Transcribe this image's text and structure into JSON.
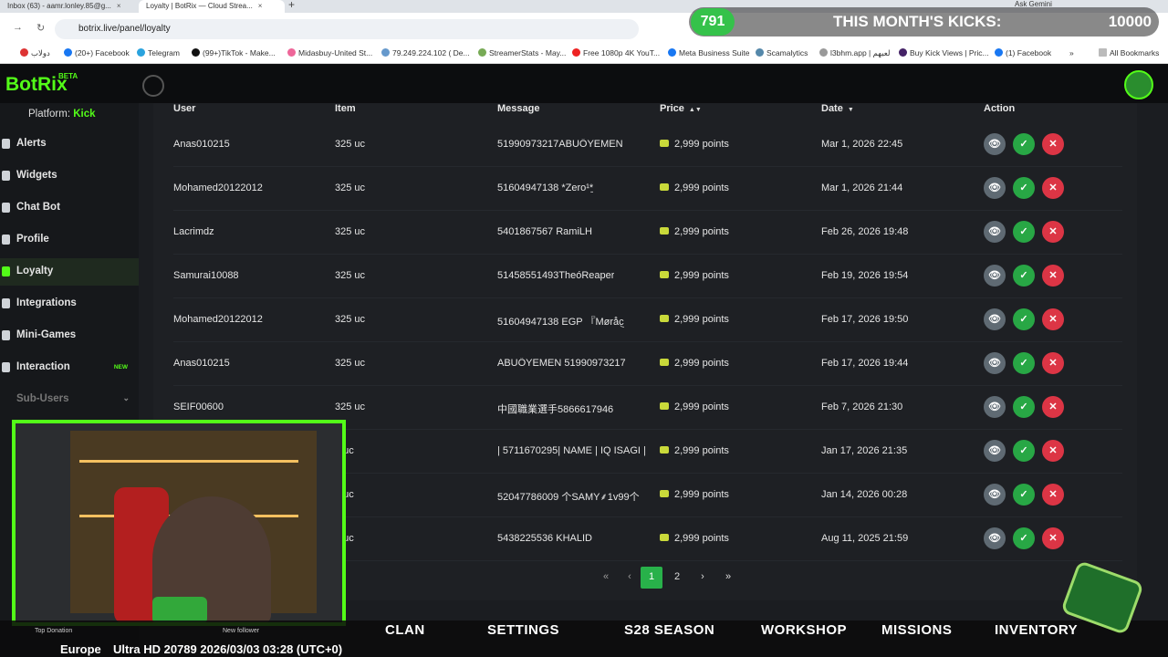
{
  "browser": {
    "tabs": [
      {
        "label": "Inbox (63) - aamr.lonley.85@g..."
      },
      {
        "label": "Loyalty | BotRix — Cloud Strea..."
      }
    ],
    "new_tab": "+",
    "ask_gemini": "Ask Gemini",
    "url": "botrix.live/panel/loyalty",
    "bookmarks": [
      "دولاب",
      "(20+) Facebook",
      "Telegram",
      "(99+)TikTok - Make...",
      "Midasbuy-United St...",
      "79.249.224.102 ( De...",
      "StreamerStats - May...",
      "Free 1080p 4K YouT...",
      "Meta Business Suite",
      "Scamalytics",
      "l3bhm.app | لعبهم",
      "Buy Kick Views | Pric...",
      "(1) Facebook",
      "»",
      "All Bookmarks"
    ]
  },
  "kicks_overlay": {
    "count": "791",
    "label": "THIS MONTH'S KICKS:",
    "goal": "10000"
  },
  "app": {
    "logo": "BotRix",
    "beta": "BETA"
  },
  "sidebar": {
    "platform_label": "Platform:",
    "platform_value": "Kick",
    "items": [
      {
        "label": "Alerts"
      },
      {
        "label": "Widgets"
      },
      {
        "label": "Chat Bot"
      },
      {
        "label": "Profile"
      },
      {
        "label": "Loyalty"
      },
      {
        "label": "Integrations"
      },
      {
        "label": "Mini-Games"
      },
      {
        "label": "Interaction",
        "badge": "NEW"
      },
      {
        "label": "Sub-Users"
      }
    ]
  },
  "table": {
    "headers": [
      "User",
      "Item",
      "Message",
      "Price",
      "Date",
      "Action"
    ],
    "rows": [
      {
        "user": "Anas010215",
        "item": "325 uc",
        "message": "51990973217ABUŐYEMEN",
        "price": "2,999 points",
        "date": "Mar 1, 2026 22:45"
      },
      {
        "user": "Mohamed20122012",
        "item": "325 uc",
        "message": "51604947138 *Zero¹*͟",
        "price": "2,999 points",
        "date": "Mar 1, 2026 21:44"
      },
      {
        "user": "Lacrimdz",
        "item": "325 uc",
        "message": "5401867567 RamiLH",
        "price": "2,999 points",
        "date": "Feb 26, 2026 19:48"
      },
      {
        "user": "Samurai10088",
        "item": "325 uc",
        "message": "51458551493TheóReaper",
        "price": "2,999 points",
        "date": "Feb 19, 2026 19:54"
      },
      {
        "user": "Mohamed20122012",
        "item": "325 uc",
        "message": "51604947138 EGP 『Møråc͜",
        "price": "2,999 points",
        "date": "Feb 17, 2026 19:50"
      },
      {
        "user": "Anas010215",
        "item": "325 uc",
        "message": "ABUŐYEMEN 51990973217",
        "price": "2,999 points",
        "date": "Feb 17, 2026 19:44"
      },
      {
        "user": "SEIF00600",
        "item": "325 uc",
        "message": "中國職業選手5866617946",
        "price": "2,999 points",
        "date": "Feb 7, 2026 21:30"
      },
      {
        "user": "",
        "item": "5 uc",
        "message": "| 5711670295| NAME | IQ ISAGI |",
        "price": "2,999 points",
        "date": "Jan 17, 2026 21:35"
      },
      {
        "user": "",
        "item": "5 uc",
        "message": "52047786009 个SAMY⸙1v99个",
        "price": "2,999 points",
        "date": "Jan 14, 2026 00:28"
      },
      {
        "user": "",
        "item": "5 uc",
        "message": "5438225536 KHALID",
        "price": "2,999 points",
        "date": "Aug 11, 2025 21:59"
      }
    ]
  },
  "pagination": {
    "first": "«",
    "prev": "‹",
    "pages": [
      "1",
      "2"
    ],
    "next": "›",
    "last": "»"
  },
  "game_bar": {
    "menu": [
      "CLAN",
      "SETTINGS",
      "S28 SEASON",
      "WORKSHOP",
      "MISSIONS",
      "INVENTORY"
    ],
    "top_donation": "Top Donation",
    "new_follower": "New follower",
    "region": "Europe",
    "status": "Ultra HD  20789 2026/03/03 03:28 (UTC+0)"
  }
}
